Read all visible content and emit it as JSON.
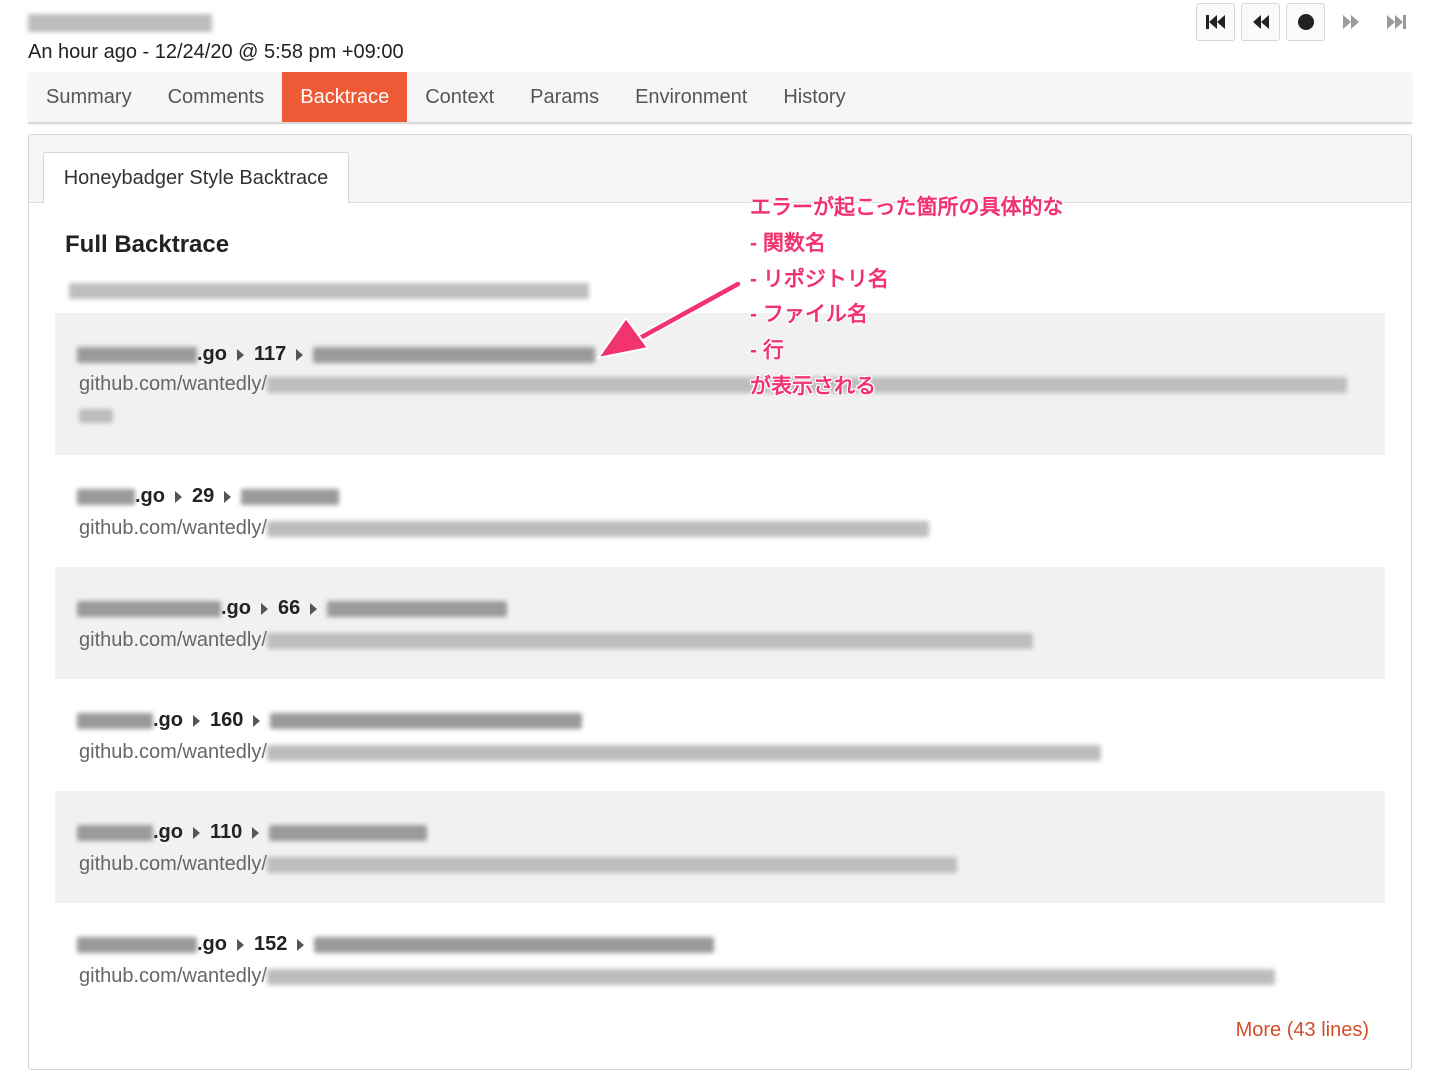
{
  "header": {
    "timestamp": "An hour ago - 12/24/20 @ 5:58 pm +09:00"
  },
  "nav_buttons": [
    {
      "icon": "skip-to-first-icon"
    },
    {
      "icon": "previous-icon"
    },
    {
      "icon": "record-dot-icon"
    },
    {
      "icon": "next-icon"
    },
    {
      "icon": "skip-to-last-icon"
    }
  ],
  "tabs": [
    {
      "label": "Summary",
      "active": false
    },
    {
      "label": "Comments",
      "active": false
    },
    {
      "label": "Backtrace",
      "active": true
    },
    {
      "label": "Context",
      "active": false
    },
    {
      "label": "Params",
      "active": false
    },
    {
      "label": "Environment",
      "active": false
    },
    {
      "label": "History",
      "active": false
    }
  ],
  "subtab": {
    "label": "Honeybadger Style Backtrace"
  },
  "section": {
    "title": "Full Backtrace"
  },
  "frames": [
    {
      "file_suffix": ".go",
      "line": "117",
      "repo_prefix": "github.com/wantedly/"
    },
    {
      "file_suffix": ".go",
      "line": "29",
      "repo_prefix": "github.com/wantedly/"
    },
    {
      "file_suffix": ".go",
      "line": "66",
      "repo_prefix": "github.com/wantedly/"
    },
    {
      "file_suffix": ".go",
      "line": "160",
      "repo_prefix": "github.com/wantedly/"
    },
    {
      "file_suffix": ".go",
      "line": "110",
      "repo_prefix": "github.com/wantedly/"
    },
    {
      "file_suffix": ".go",
      "line": "152",
      "repo_prefix": "github.com/wantedly/"
    }
  ],
  "more_link": "More (43 lines)",
  "annotation": {
    "lines": [
      "エラーが起こった箇所の具体的な",
      "- 関数名",
      "- リポジトリ名",
      "- ファイル名",
      "- 行",
      "が表示される"
    ],
    "color": "#f1336f"
  },
  "colors": {
    "accent": "#ee5a36",
    "more_link": "#d24d2a"
  }
}
